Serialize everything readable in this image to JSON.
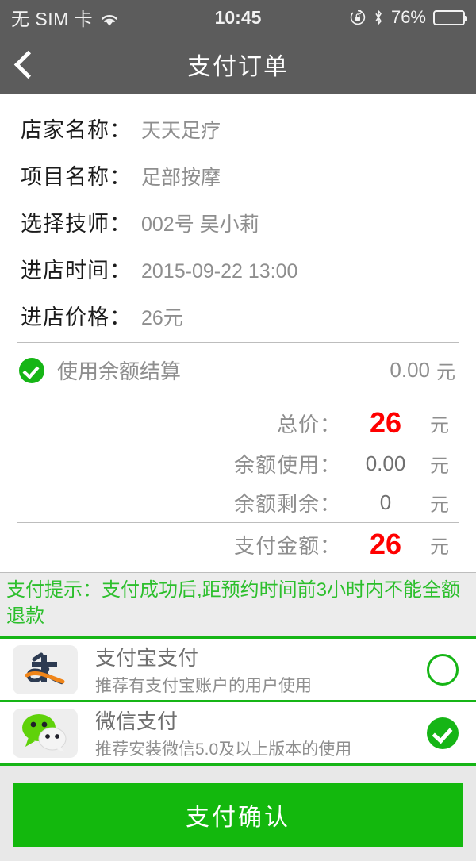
{
  "statusbar": {
    "carrier": "无 SIM 卡",
    "wifi_icon": "wifi-icon",
    "time": "10:45",
    "rotation_lock_icon": "rotation-lock-icon",
    "bluetooth_icon": "bluetooth-icon",
    "battery_percent": "76%",
    "battery_level": 76
  },
  "header": {
    "back_icon": "back-chevron-icon",
    "title": "支付订单"
  },
  "order_info": [
    {
      "label": "店家名称：",
      "value": "天天足疗"
    },
    {
      "label": "项目名称：",
      "value": "足部按摩"
    },
    {
      "label": "选择技师：",
      "value": "002号 吴小莉"
    },
    {
      "label": "进店时间：",
      "value": "2015-09-22 13:00"
    },
    {
      "label": "进店价格：",
      "value": "26元"
    }
  ],
  "balance": {
    "checked": true,
    "label": "使用余额结算",
    "amount": "0.00",
    "unit": "元"
  },
  "summary": [
    {
      "label": "总价：",
      "value": "26",
      "unit": "元",
      "highlight": true
    },
    {
      "label": "余额使用：",
      "value": "0.00",
      "unit": "元",
      "highlight": false
    },
    {
      "label": "余额剩余：",
      "value": "0",
      "unit": "元",
      "highlight": false
    },
    {
      "label": "支付金额：",
      "value": "26",
      "unit": "元",
      "highlight": true
    }
  ],
  "notice": {
    "text": "支付提示：支付成功后,距预约时间前3小时内不能全额退款"
  },
  "payment_methods": [
    {
      "icon": "alipay-icon",
      "title": "支付宝支付",
      "subtitle": "推荐有支付宝账户的用户使用",
      "selected": false
    },
    {
      "icon": "wechat-pay-icon",
      "title": "微信支付",
      "subtitle": "推荐安装微信5.0及以上版本的使用",
      "selected": true
    }
  ],
  "footer": {
    "confirm_label": "支付确认"
  },
  "colors": {
    "header_bg": "#5c5c5c",
    "green": "#16b516",
    "button_green": "#13b80d",
    "price_red": "#ff0000",
    "notice_bg": "#ececec",
    "notice_text": "#2cbf2c"
  }
}
